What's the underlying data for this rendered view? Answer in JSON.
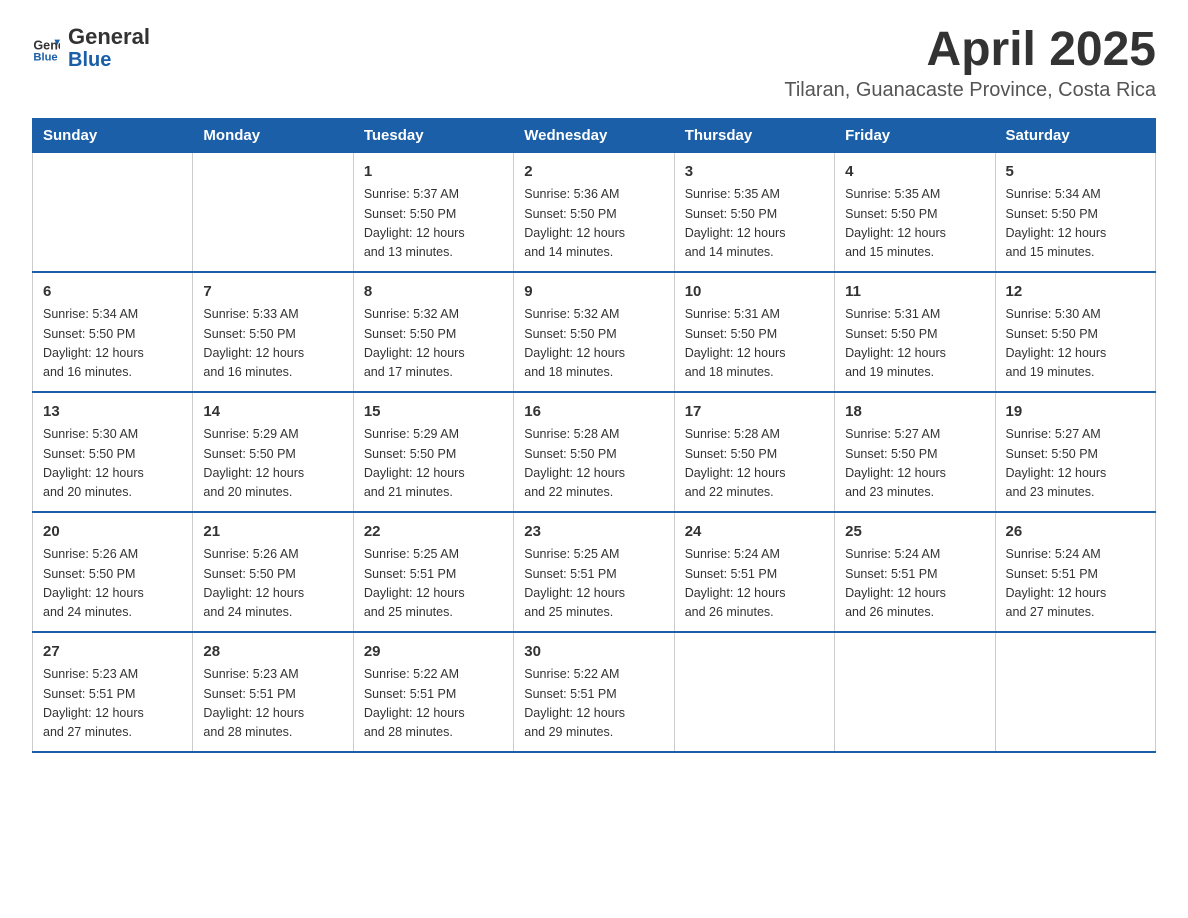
{
  "header": {
    "logo_text_black": "General",
    "logo_text_blue": "Blue",
    "month_year": "April 2025",
    "location": "Tilaran, Guanacaste Province, Costa Rica"
  },
  "columns": [
    "Sunday",
    "Monday",
    "Tuesday",
    "Wednesday",
    "Thursday",
    "Friday",
    "Saturday"
  ],
  "weeks": [
    [
      {
        "day": "",
        "info": ""
      },
      {
        "day": "",
        "info": ""
      },
      {
        "day": "1",
        "info": "Sunrise: 5:37 AM\nSunset: 5:50 PM\nDaylight: 12 hours\nand 13 minutes."
      },
      {
        "day": "2",
        "info": "Sunrise: 5:36 AM\nSunset: 5:50 PM\nDaylight: 12 hours\nand 14 minutes."
      },
      {
        "day": "3",
        "info": "Sunrise: 5:35 AM\nSunset: 5:50 PM\nDaylight: 12 hours\nand 14 minutes."
      },
      {
        "day": "4",
        "info": "Sunrise: 5:35 AM\nSunset: 5:50 PM\nDaylight: 12 hours\nand 15 minutes."
      },
      {
        "day": "5",
        "info": "Sunrise: 5:34 AM\nSunset: 5:50 PM\nDaylight: 12 hours\nand 15 minutes."
      }
    ],
    [
      {
        "day": "6",
        "info": "Sunrise: 5:34 AM\nSunset: 5:50 PM\nDaylight: 12 hours\nand 16 minutes."
      },
      {
        "day": "7",
        "info": "Sunrise: 5:33 AM\nSunset: 5:50 PM\nDaylight: 12 hours\nand 16 minutes."
      },
      {
        "day": "8",
        "info": "Sunrise: 5:32 AM\nSunset: 5:50 PM\nDaylight: 12 hours\nand 17 minutes."
      },
      {
        "day": "9",
        "info": "Sunrise: 5:32 AM\nSunset: 5:50 PM\nDaylight: 12 hours\nand 18 minutes."
      },
      {
        "day": "10",
        "info": "Sunrise: 5:31 AM\nSunset: 5:50 PM\nDaylight: 12 hours\nand 18 minutes."
      },
      {
        "day": "11",
        "info": "Sunrise: 5:31 AM\nSunset: 5:50 PM\nDaylight: 12 hours\nand 19 minutes."
      },
      {
        "day": "12",
        "info": "Sunrise: 5:30 AM\nSunset: 5:50 PM\nDaylight: 12 hours\nand 19 minutes."
      }
    ],
    [
      {
        "day": "13",
        "info": "Sunrise: 5:30 AM\nSunset: 5:50 PM\nDaylight: 12 hours\nand 20 minutes."
      },
      {
        "day": "14",
        "info": "Sunrise: 5:29 AM\nSunset: 5:50 PM\nDaylight: 12 hours\nand 20 minutes."
      },
      {
        "day": "15",
        "info": "Sunrise: 5:29 AM\nSunset: 5:50 PM\nDaylight: 12 hours\nand 21 minutes."
      },
      {
        "day": "16",
        "info": "Sunrise: 5:28 AM\nSunset: 5:50 PM\nDaylight: 12 hours\nand 22 minutes."
      },
      {
        "day": "17",
        "info": "Sunrise: 5:28 AM\nSunset: 5:50 PM\nDaylight: 12 hours\nand 22 minutes."
      },
      {
        "day": "18",
        "info": "Sunrise: 5:27 AM\nSunset: 5:50 PM\nDaylight: 12 hours\nand 23 minutes."
      },
      {
        "day": "19",
        "info": "Sunrise: 5:27 AM\nSunset: 5:50 PM\nDaylight: 12 hours\nand 23 minutes."
      }
    ],
    [
      {
        "day": "20",
        "info": "Sunrise: 5:26 AM\nSunset: 5:50 PM\nDaylight: 12 hours\nand 24 minutes."
      },
      {
        "day": "21",
        "info": "Sunrise: 5:26 AM\nSunset: 5:50 PM\nDaylight: 12 hours\nand 24 minutes."
      },
      {
        "day": "22",
        "info": "Sunrise: 5:25 AM\nSunset: 5:51 PM\nDaylight: 12 hours\nand 25 minutes."
      },
      {
        "day": "23",
        "info": "Sunrise: 5:25 AM\nSunset: 5:51 PM\nDaylight: 12 hours\nand 25 minutes."
      },
      {
        "day": "24",
        "info": "Sunrise: 5:24 AM\nSunset: 5:51 PM\nDaylight: 12 hours\nand 26 minutes."
      },
      {
        "day": "25",
        "info": "Sunrise: 5:24 AM\nSunset: 5:51 PM\nDaylight: 12 hours\nand 26 minutes."
      },
      {
        "day": "26",
        "info": "Sunrise: 5:24 AM\nSunset: 5:51 PM\nDaylight: 12 hours\nand 27 minutes."
      }
    ],
    [
      {
        "day": "27",
        "info": "Sunrise: 5:23 AM\nSunset: 5:51 PM\nDaylight: 12 hours\nand 27 minutes."
      },
      {
        "day": "28",
        "info": "Sunrise: 5:23 AM\nSunset: 5:51 PM\nDaylight: 12 hours\nand 28 minutes."
      },
      {
        "day": "29",
        "info": "Sunrise: 5:22 AM\nSunset: 5:51 PM\nDaylight: 12 hours\nand 28 minutes."
      },
      {
        "day": "30",
        "info": "Sunrise: 5:22 AM\nSunset: 5:51 PM\nDaylight: 12 hours\nand 29 minutes."
      },
      {
        "day": "",
        "info": ""
      },
      {
        "day": "",
        "info": ""
      },
      {
        "day": "",
        "info": ""
      }
    ]
  ]
}
